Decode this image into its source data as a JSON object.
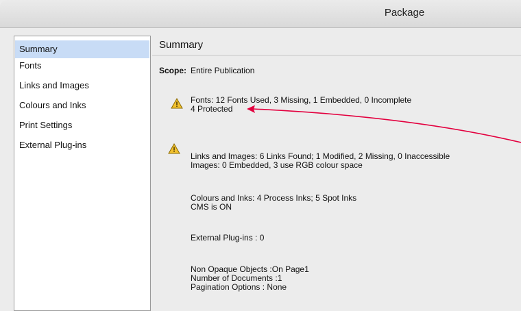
{
  "window": {
    "title": "Package"
  },
  "sidebar": {
    "items": [
      {
        "label": "Summary"
      },
      {
        "label": "Fonts"
      },
      {
        "label": "Links and Images"
      },
      {
        "label": "Colours and Inks"
      },
      {
        "label": "Print Settings"
      },
      {
        "label": "External Plug-ins"
      }
    ],
    "selected": "Summary"
  },
  "summary": {
    "title": "Summary",
    "scope_label": "Scope:",
    "scope_value": "Entire Publication",
    "fonts_line1": "Fonts: 12 Fonts Used, 3 Missing, 1 Embedded, 0 Incomplete",
    "fonts_line2": "4 Protected",
    "links_line1": "Links and Images: 6 Links Found; 1 Modified, 2 Missing, 0 Inaccessible",
    "links_line2": "Images: 0 Embedded, 3 use RGB colour space",
    "colours_line1": "Colours and Inks: 4 Process Inks; 5 Spot Inks",
    "colours_line2": "CMS is ON",
    "plugins_line1": "External Plug-ins : 0",
    "misc_line1": "Non Opaque Objects :On Page1",
    "misc_line2": "Number of Documents :1",
    "misc_line3": "Pagination Options : None"
  },
  "colors": {
    "selection": "#c8dcf6",
    "warning": "#f2c12e",
    "annotation_arrow": "#e3003f"
  },
  "icons": [
    "warning-icon"
  ]
}
